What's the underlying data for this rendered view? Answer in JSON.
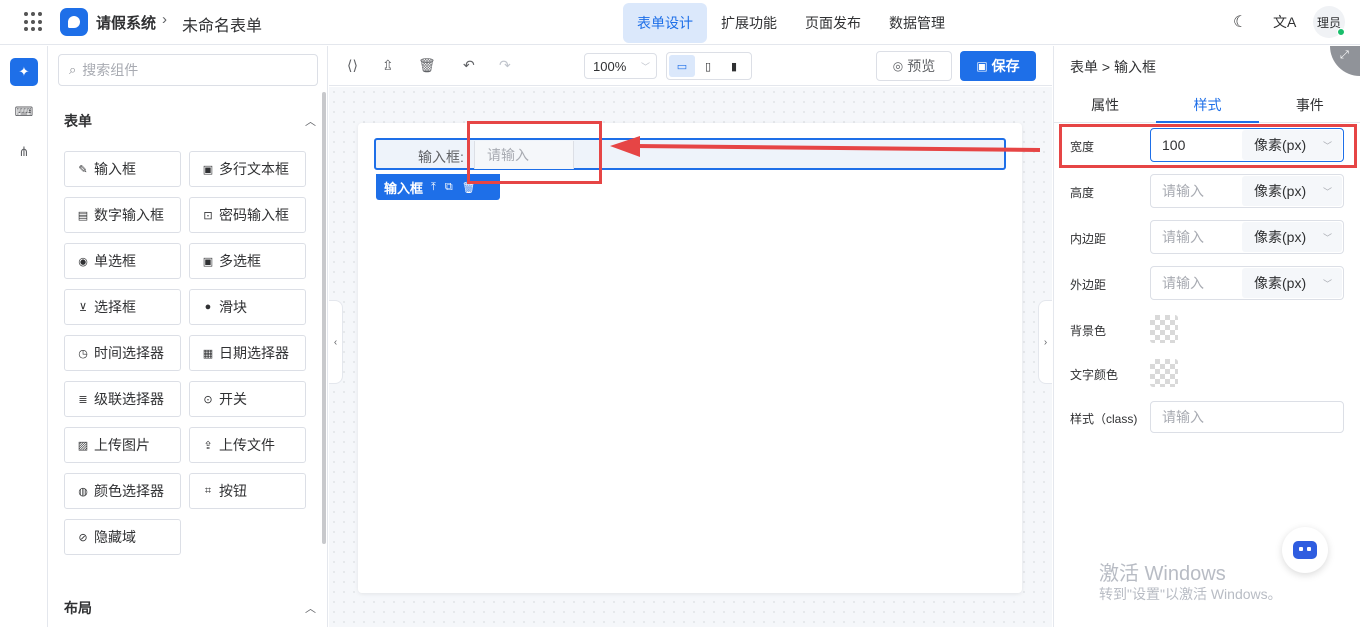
{
  "header": {
    "app_title": "请假系统",
    "form_name": "未命名表单",
    "nav_tabs": [
      {
        "label": "表单设计",
        "active": true
      },
      {
        "label": "扩展功能",
        "active": false
      },
      {
        "label": "页面发布",
        "active": false
      },
      {
        "label": "数据管理",
        "active": false
      }
    ],
    "user_name": "理员",
    "online_color": "#19be6b",
    "brand_color": "#1e6fe8"
  },
  "rail": {
    "items": [
      {
        "icon": "puzzle-icon",
        "active": true
      },
      {
        "icon": "code-icon",
        "active": false
      },
      {
        "icon": "tree-icon",
        "active": false
      }
    ]
  },
  "component_panel": {
    "search_placeholder": "搜索组件",
    "section_form": "表单",
    "section_layout": "布局",
    "components": [
      {
        "label": "输入框",
        "icon": "edit-icon"
      },
      {
        "label": "多行文本框",
        "icon": "textarea-icon"
      },
      {
        "label": "数字输入框",
        "icon": "number-icon"
      },
      {
        "label": "密码输入框",
        "icon": "lock-icon"
      },
      {
        "label": "单选框",
        "icon": "radio-icon"
      },
      {
        "label": "多选框",
        "icon": "checkbox-icon"
      },
      {
        "label": "选择框",
        "icon": "select-icon"
      },
      {
        "label": "滑块",
        "icon": "slider-icon"
      },
      {
        "label": "时间选择器",
        "icon": "clock-icon"
      },
      {
        "label": "日期选择器",
        "icon": "calendar-icon"
      },
      {
        "label": "级联选择器",
        "icon": "cascader-icon"
      },
      {
        "label": "开关",
        "icon": "switch-icon"
      },
      {
        "label": "上传图片",
        "icon": "image-icon"
      },
      {
        "label": "上传文件",
        "icon": "upload-icon"
      },
      {
        "label": "颜色选择器",
        "icon": "palette-icon"
      },
      {
        "label": "按钮",
        "icon": "button-icon"
      },
      {
        "label": "隐藏域",
        "icon": "eye-off-icon"
      }
    ]
  },
  "toolbar": {
    "zoom": "100%",
    "preview_label": "预览",
    "save_label": "保存"
  },
  "canvas": {
    "field_label": "输入框:",
    "field_placeholder": "请输入",
    "field_toolbar_label": "输入框"
  },
  "props": {
    "breadcrumb": "表单 > 输入框",
    "tabs": [
      {
        "label": "属性",
        "active": false
      },
      {
        "label": "样式",
        "active": true
      },
      {
        "label": "事件",
        "active": false
      }
    ],
    "width_label": "宽度",
    "width_value": "100",
    "height_label": "高度",
    "padding_label": "内边距",
    "margin_label": "外边距",
    "input_placeholder": "请输入",
    "unit_label": "像素(px)",
    "bg_color_label": "背景色",
    "text_color_label": "文字颜色",
    "class_label": "样式（class)"
  },
  "annotation": {
    "highlight_color": "#e64545"
  },
  "watermark": {
    "title": "激活 Windows",
    "subtitle": "转到\"设置\"以激活 Windows。"
  }
}
